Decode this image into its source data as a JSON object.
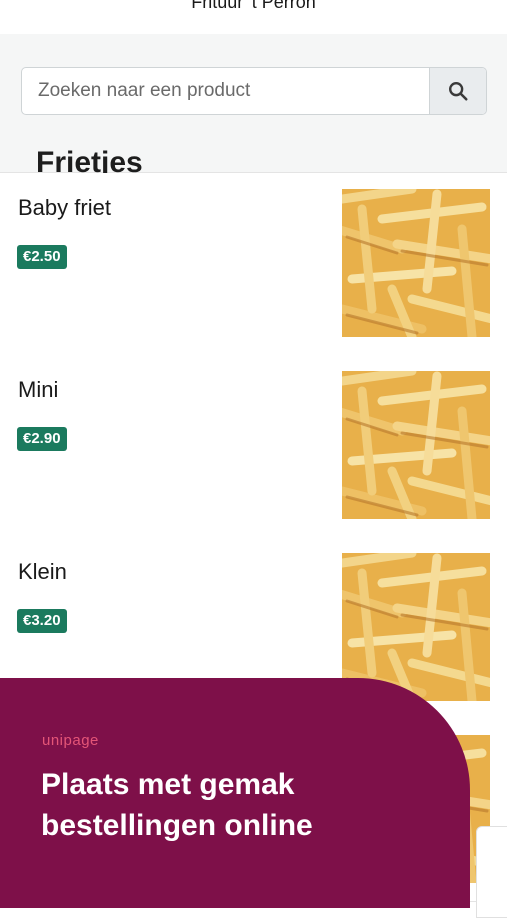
{
  "header": {
    "title": "Frituur 't Perron"
  },
  "search": {
    "placeholder": "Zoeken naar een product"
  },
  "category": {
    "title": "Frietjes"
  },
  "products": [
    {
      "name": "Baby friet",
      "price": "€2.50"
    },
    {
      "name": "Mini",
      "price": "€2.90"
    },
    {
      "name": "Klein",
      "price": "€3.20"
    },
    {
      "name": "",
      "price": ""
    }
  ],
  "banner": {
    "brand": "unipage",
    "headline": "Plaats met gemak bestellingen online"
  },
  "colors": {
    "price_badge": "#1b7a5e",
    "banner_bg": "#7e1049",
    "brand_accent": "#e45577"
  }
}
